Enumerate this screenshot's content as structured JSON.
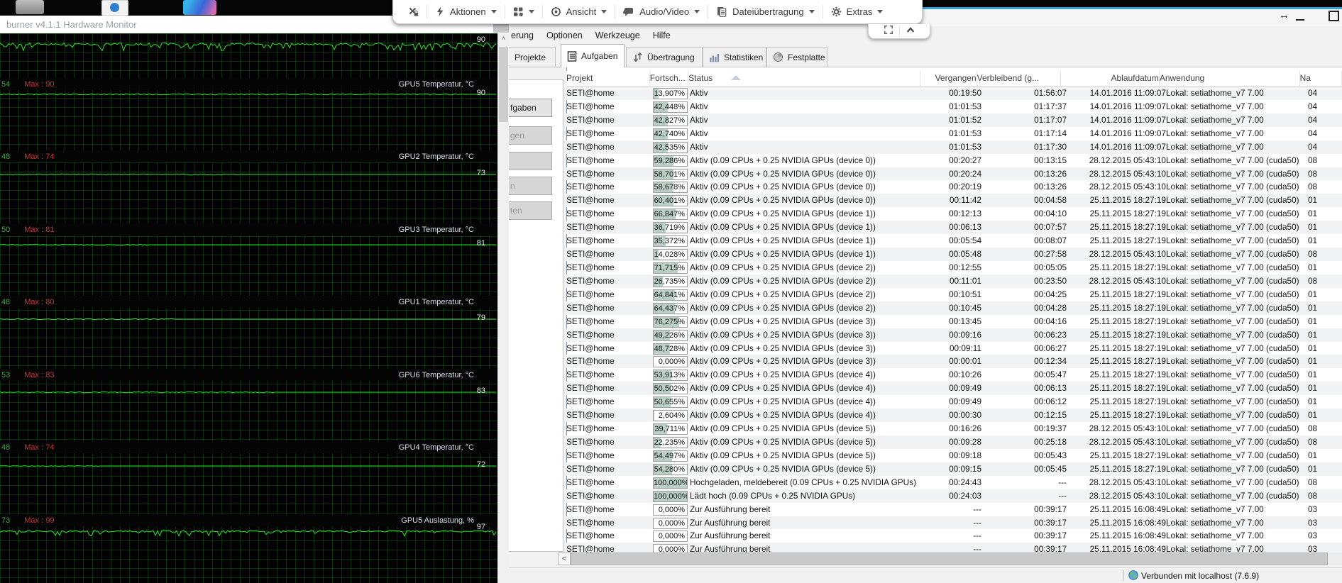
{
  "toolbar": {
    "items": [
      {
        "icon": "session-lock"
      },
      {
        "divider": true
      },
      {
        "icon": "lightning",
        "label": "Aktionen",
        "caret": true
      },
      {
        "divider": true
      },
      {
        "icon": "apps-grid",
        "caret": true
      },
      {
        "divider": true
      },
      {
        "icon": "view",
        "label": "Ansicht",
        "caret": true
      },
      {
        "divider": true
      },
      {
        "icon": "chat",
        "label": "Audio/Video",
        "caret": true
      },
      {
        "divider": true
      },
      {
        "icon": "file-transfer",
        "label": "Dateiübertragung",
        "caret": true
      },
      {
        "divider": true
      },
      {
        "icon": "gear",
        "label": "Extras",
        "caret": true
      }
    ]
  },
  "afterburner": {
    "title": "burner v4.1.1 Hardware Monitor",
    "top_section": {
      "value": "90"
    },
    "sections": [
      {
        "min": "54",
        "max": "Max : 90",
        "label": "GPU5 Temperatur, °C",
        "value": "90"
      },
      {
        "min": "48",
        "max": "Max : 74",
        "label": "GPU2 Temperatur, °C",
        "value": "73"
      },
      {
        "min": "50",
        "max": "Max : 81",
        "label": "GPU3 Temperatur, °C",
        "value": "81"
      },
      {
        "min": "48",
        "max": "Max : 80",
        "label": "GPU1 Temperatur, °C",
        "value": "79"
      },
      {
        "min": "53",
        "max": "Max : 83",
        "label": "GPU6 Temperatur, °C",
        "value": "83"
      },
      {
        "min": "48",
        "max": "Max : 74",
        "label": "GPU4 Temperatur, °C",
        "value": "72"
      },
      {
        "min": "73",
        "max": "Max : 99",
        "label": "GPU5 Auslastung, %",
        "value": "97"
      }
    ]
  },
  "boinc": {
    "menu": [
      "erung",
      "Optionen",
      "Werkzeuge",
      "Hilfe"
    ],
    "tabs": [
      {
        "label": "Projekte"
      },
      {
        "label": "Aufgaben",
        "icon": "tasks",
        "active": true
      },
      {
        "label": "Übertragung",
        "icon": "transfer"
      },
      {
        "label": "Statistiken",
        "icon": "stats"
      },
      {
        "label": "Festplatte",
        "icon": "disk"
      }
    ],
    "commands": [
      "fgaben",
      "gen",
      "",
      "n",
      "ten"
    ],
    "table": {
      "columns": [
        "Projekt",
        "Fortsch...",
        "Status",
        "Vergangen",
        "Verbleibend (g...",
        "Ablaufdatum",
        "Anwendung",
        "Na"
      ],
      "rows": [
        [
          "SETI@home",
          "13,907%",
          "Aktiv",
          "00:19:50",
          "01:56:07",
          "14.01.2016 11:09:07",
          "Lokal: setiathome_v7 7.00",
          "04"
        ],
        [
          "SETI@home",
          "42,448%",
          "Aktiv",
          "01:01:53",
          "01:17:37",
          "14.01.2016 11:09:07",
          "Lokal: setiathome_v7 7.00",
          "04"
        ],
        [
          "SETI@home",
          "42,827%",
          "Aktiv",
          "01:01:52",
          "01:17:07",
          "14.01.2016 11:09:07",
          "Lokal: setiathome_v7 7.00",
          "04"
        ],
        [
          "SETI@home",
          "42,740%",
          "Aktiv",
          "01:01:53",
          "01:17:14",
          "14.01.2016 11:09:07",
          "Lokal: setiathome_v7 7.00",
          "04"
        ],
        [
          "SETI@home",
          "42,535%",
          "Aktiv",
          "01:01:53",
          "01:17:30",
          "14.01.2016 11:09:07",
          "Lokal: setiathome_v7 7.00",
          "04"
        ],
        [
          "SETI@home",
          "59,286%",
          "Aktiv (0.09 CPUs + 0.25 NVIDIA GPUs (device 0))",
          "00:20:27",
          "00:13:15",
          "28.12.2015 05:43:10",
          "Lokal: setiathome_v7 7.00  (cuda50)",
          "08"
        ],
        [
          "SETI@home",
          "58,701%",
          "Aktiv (0.09 CPUs + 0.25 NVIDIA GPUs (device 0))",
          "00:20:24",
          "00:13:26",
          "28.12.2015 05:43:10",
          "Lokal: setiathome_v7 7.00  (cuda50)",
          "08"
        ],
        [
          "SETI@home",
          "58,678%",
          "Aktiv (0.09 CPUs + 0.25 NVIDIA GPUs (device 0))",
          "00:20:19",
          "00:13:26",
          "28.12.2015 05:43:10",
          "Lokal: setiathome_v7 7.00  (cuda50)",
          "08"
        ],
        [
          "SETI@home",
          "60,401%",
          "Aktiv (0.09 CPUs + 0.25 NVIDIA GPUs (device 0))",
          "00:11:42",
          "00:04:58",
          "25.11.2015 18:27:19",
          "Lokal: setiathome_v7 7.00  (cuda50)",
          "01"
        ],
        [
          "SETI@home",
          "66,847%",
          "Aktiv (0.09 CPUs + 0.25 NVIDIA GPUs (device 1))",
          "00:12:13",
          "00:04:10",
          "25.11.2015 18:27:19",
          "Lokal: setiathome_v7 7.00  (cuda50)",
          "01"
        ],
        [
          "SETI@home",
          "36,719%",
          "Aktiv (0.09 CPUs + 0.25 NVIDIA GPUs (device 1))",
          "00:06:13",
          "00:07:57",
          "25.11.2015 18:27:19",
          "Lokal: setiathome_v7 7.00  (cuda50)",
          "01"
        ],
        [
          "SETI@home",
          "35,372%",
          "Aktiv (0.09 CPUs + 0.25 NVIDIA GPUs (device 1))",
          "00:05:54",
          "00:08:07",
          "25.11.2015 18:27:19",
          "Lokal: setiathome_v7 7.00  (cuda50)",
          "01"
        ],
        [
          "SETI@home",
          "14,028%",
          "Aktiv (0.09 CPUs + 0.25 NVIDIA GPUs (device 1))",
          "00:05:48",
          "00:27:58",
          "28.12.2015 05:43:10",
          "Lokal: setiathome_v7 7.00  (cuda50)",
          "08"
        ],
        [
          "SETI@home",
          "71,715%",
          "Aktiv (0.09 CPUs + 0.25 NVIDIA GPUs (device 2))",
          "00:12:55",
          "00:05:05",
          "25.11.2015 18:27:19",
          "Lokal: setiathome_v7 7.00  (cuda50)",
          "01"
        ],
        [
          "SETI@home",
          "26,735%",
          "Aktiv (0.09 CPUs + 0.25 NVIDIA GPUs (device 2))",
          "00:11:01",
          "00:23:50",
          "28.12.2015 05:43:10",
          "Lokal: setiathome_v7 7.00  (cuda50)",
          "08"
        ],
        [
          "SETI@home",
          "64,841%",
          "Aktiv (0.09 CPUs + 0.25 NVIDIA GPUs (device 2))",
          "00:10:51",
          "00:04:25",
          "25.11.2015 18:27:19",
          "Lokal: setiathome_v7 7.00  (cuda50)",
          "01"
        ],
        [
          "SETI@home",
          "64,437%",
          "Aktiv (0.09 CPUs + 0.25 NVIDIA GPUs (device 2))",
          "00:10:45",
          "00:04:28",
          "25.11.2015 18:27:19",
          "Lokal: setiathome_v7 7.00  (cuda50)",
          "01"
        ],
        [
          "SETI@home",
          "76,275%",
          "Aktiv (0.09 CPUs + 0.25 NVIDIA GPUs (device 3))",
          "00:13:45",
          "00:04:16",
          "25.11.2015 18:27:19",
          "Lokal: setiathome_v7 7.00  (cuda50)",
          "01"
        ],
        [
          "SETI@home",
          "49,226%",
          "Aktiv (0.09 CPUs + 0.25 NVIDIA GPUs (device 3))",
          "00:09:16",
          "00:06:23",
          "25.11.2015 18:27:19",
          "Lokal: setiathome_v7 7.00  (cuda50)",
          "01"
        ],
        [
          "SETI@home",
          "48,728%",
          "Aktiv (0.09 CPUs + 0.25 NVIDIA GPUs (device 3))",
          "00:09:11",
          "00:06:27",
          "25.11.2015 18:27:19",
          "Lokal: setiathome_v7 7.00  (cuda50)",
          "01"
        ],
        [
          "SETI@home",
          "0,000%",
          "Aktiv (0.09 CPUs + 0.25 NVIDIA GPUs (device 3))",
          "00:00:01",
          "00:12:34",
          "25.11.2015 18:27:19",
          "Lokal: setiathome_v7 7.00  (cuda50)",
          "01"
        ],
        [
          "SETI@home",
          "53,913%",
          "Aktiv (0.09 CPUs + 0.25 NVIDIA GPUs (device 4))",
          "00:10:26",
          "00:05:47",
          "25.11.2015 18:27:19",
          "Lokal: setiathome_v7 7.00  (cuda50)",
          "01"
        ],
        [
          "SETI@home",
          "50,502%",
          "Aktiv (0.09 CPUs + 0.25 NVIDIA GPUs (device 4))",
          "00:09:49",
          "00:06:13",
          "25.11.2015 18:27:19",
          "Lokal: setiathome_v7 7.00  (cuda50)",
          "01"
        ],
        [
          "SETI@home",
          "50,655%",
          "Aktiv (0.09 CPUs + 0.25 NVIDIA GPUs (device 4))",
          "00:09:49",
          "00:06:12",
          "25.11.2015 18:27:19",
          "Lokal: setiathome_v7 7.00  (cuda50)",
          "01"
        ],
        [
          "SETI@home",
          "2,604%",
          "Aktiv (0.09 CPUs + 0.25 NVIDIA GPUs (device 4))",
          "00:00:30",
          "00:12:15",
          "25.11.2015 18:27:19",
          "Lokal: setiathome_v7 7.00  (cuda50)",
          "01"
        ],
        [
          "SETI@home",
          "39,711%",
          "Aktiv (0.09 CPUs + 0.25 NVIDIA GPUs (device 5))",
          "00:16:26",
          "00:19:37",
          "28.12.2015 05:43:10",
          "Lokal: setiathome_v7 7.00  (cuda50)",
          "08"
        ],
        [
          "SETI@home",
          "22,235%",
          "Aktiv (0.09 CPUs + 0.25 NVIDIA GPUs (device 5))",
          "00:09:28",
          "00:25:18",
          "28.12.2015 05:43:10",
          "Lokal: setiathome_v7 7.00  (cuda50)",
          "08"
        ],
        [
          "SETI@home",
          "54,497%",
          "Aktiv (0.09 CPUs + 0.25 NVIDIA GPUs (device 5))",
          "00:09:18",
          "00:05:43",
          "25.11.2015 18:27:19",
          "Lokal: setiathome_v7 7.00  (cuda50)",
          "01"
        ],
        [
          "SETI@home",
          "54,280%",
          "Aktiv (0.09 CPUs + 0.25 NVIDIA GPUs (device 5))",
          "00:09:15",
          "00:05:45",
          "25.11.2015 18:27:19",
          "Lokal: setiathome_v7 7.00  (cuda50)",
          "01"
        ],
        [
          "SETI@home",
          "100,000%",
          "Hochgeladen, meldebereit (0.09 CPUs + 0.25 NVIDIA GPUs)",
          "00:24:43",
          "---",
          "28.12.2015 05:43:10",
          "Lokal: setiathome_v7 7.00  (cuda50)",
          "08"
        ],
        [
          "SETI@home",
          "100,000%",
          "Lädt hoch (0.09 CPUs + 0.25 NVIDIA GPUs)",
          "00:24:03",
          "---",
          "28.12.2015 05:43:10",
          "Lokal: setiathome_v7 7.00  (cuda50)",
          "08"
        ],
        [
          "SETI@home",
          "0,000%",
          "Zur Ausführung bereit",
          "---",
          "00:39:17",
          "25.11.2015 16:08:49",
          "Lokal: setiathome_v7 7.00",
          "03"
        ],
        [
          "SETI@home",
          "0,000%",
          "Zur Ausführung bereit",
          "---",
          "00:39:17",
          "25.11.2015 16:08:49",
          "Lokal: setiathome_v7 7.00",
          "03"
        ],
        [
          "SETI@home",
          "0,000%",
          "Zur Ausführung bereit",
          "---",
          "00:39:17",
          "25.11.2015 16:08:49",
          "Lokal: setiathome_v7 7.00",
          "03"
        ],
        [
          "SETI@home",
          "0,000%",
          "Zur Ausführung bereit",
          "---",
          "00:39:17",
          "25.11.2015 16:08:49",
          "Lokal: setiathome_v7 7.00",
          "03"
        ]
      ]
    },
    "scroll_left_label": "<",
    "status": "Verbunden mit localhost (7.6.9)"
  }
}
